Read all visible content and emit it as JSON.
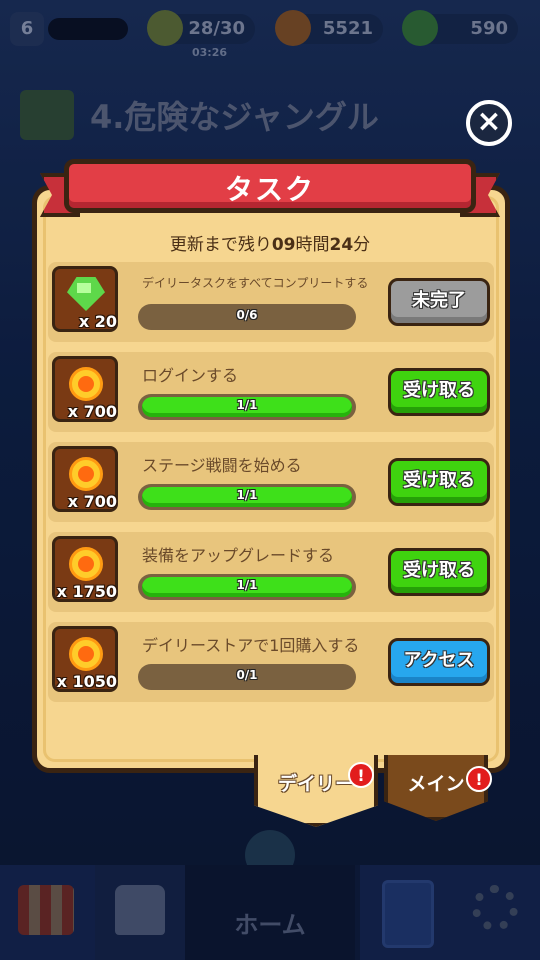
{
  "hud": {
    "player_level": "6",
    "stamina": "28/30",
    "stamina_timer": "03:26",
    "coins": "5521",
    "gems": "590"
  },
  "stage": {
    "title": "4.危険なジャングル"
  },
  "dialog": {
    "title": "タスク",
    "refresh_prefix": "更新まで残り",
    "refresh_hours": "09",
    "refresh_hours_unit": "時間",
    "refresh_minutes": "24",
    "refresh_minutes_unit": "分",
    "close_icon": "×"
  },
  "tasks": [
    {
      "label": "デイリータスクをすべてコンプリートする",
      "reward_type": "gem",
      "reward_qty": "x 20",
      "progress_text": "0/6",
      "progress": 0.0,
      "button": "未完了",
      "button_style": "gray"
    },
    {
      "label": "ログインする",
      "reward_type": "coin",
      "reward_qty": "x 700",
      "progress_text": "1/1",
      "progress": 1.0,
      "button": "受け取る",
      "button_style": "green"
    },
    {
      "label": "ステージ戦闘を始める",
      "reward_type": "coin",
      "reward_qty": "x 700",
      "progress_text": "1/1",
      "progress": 1.0,
      "button": "受け取る",
      "button_style": "green"
    },
    {
      "label": "装備をアップグレードする",
      "reward_type": "coin",
      "reward_qty": "x 1750",
      "progress_text": "1/1",
      "progress": 1.0,
      "button": "受け取る",
      "button_style": "green"
    },
    {
      "label": "デイリーストアで1回購入する",
      "reward_type": "coin",
      "reward_qty": "x 1050",
      "progress_text": "0/1",
      "progress": 0.0,
      "button": "アクセス",
      "button_style": "blue"
    }
  ],
  "tabs": {
    "daily": "デイリー",
    "main": "メイン",
    "notif_icon": "!"
  },
  "nav": {
    "home": "ホーム"
  }
}
